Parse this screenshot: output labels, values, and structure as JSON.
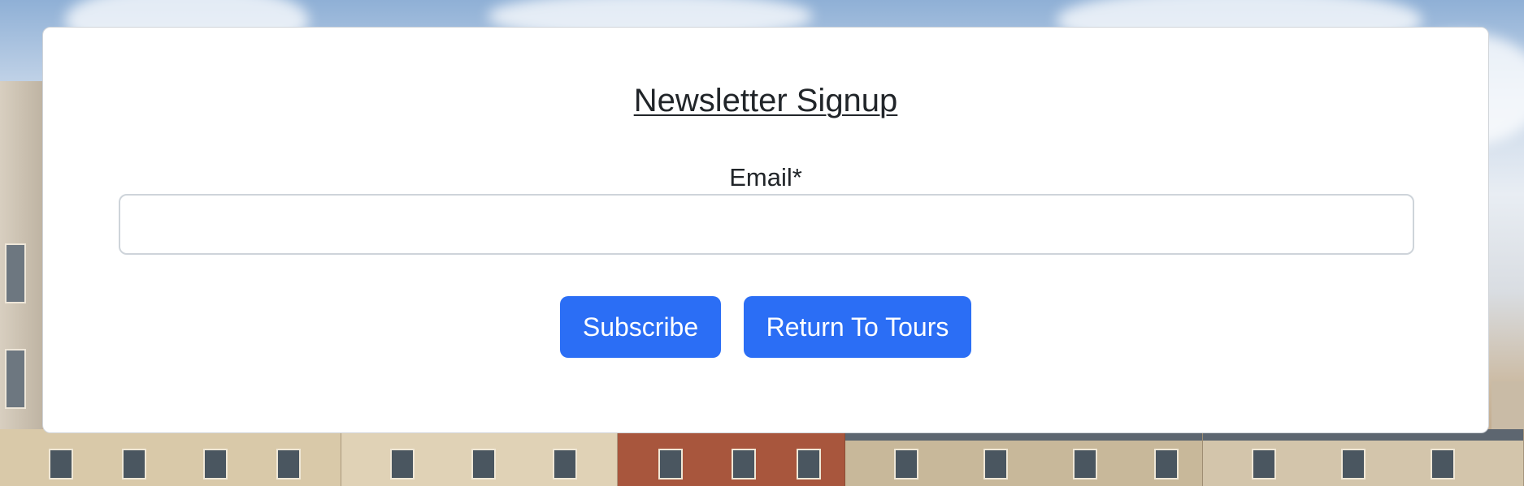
{
  "form": {
    "title": "Newsletter Signup",
    "email_label": "Email*",
    "email_value": "",
    "email_placeholder": ""
  },
  "actions": {
    "subscribe_label": "Subscribe",
    "return_label": "Return To Tours"
  },
  "colors": {
    "primary_button": "#2b6ef5",
    "text": "#212529",
    "card_border": "#d0d4d9"
  }
}
